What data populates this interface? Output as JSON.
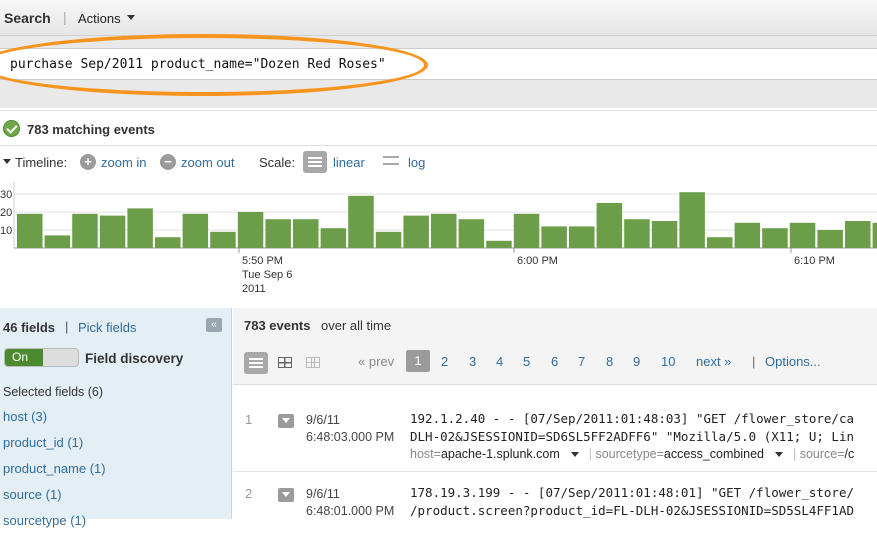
{
  "topbar": {
    "title": "Search",
    "actions_label": "Actions"
  },
  "search": {
    "query": "purchase Sep/2011 product_name=\"Dozen Red Roses\""
  },
  "results": {
    "matching_text": "783 matching events"
  },
  "timeline": {
    "label": "Timeline:",
    "zoom_in": "zoom in",
    "zoom_out": "zoom out",
    "scale_label": "Scale:",
    "linear": "linear",
    "log": "log"
  },
  "chart_data": {
    "type": "bar",
    "ylim": [
      0,
      30
    ],
    "yticks": [
      "30",
      "20",
      "10"
    ],
    "values": [
      19,
      7,
      19,
      18,
      22,
      6,
      19,
      9,
      20,
      16,
      16,
      11,
      29,
      9,
      18,
      19,
      16,
      4,
      19,
      12,
      12,
      25,
      16,
      15,
      31,
      6,
      14,
      11,
      14,
      10,
      15,
      14
    ],
    "xlabels": [
      {
        "lines": [
          "5:50 PM",
          "Tue Sep 6",
          "2011"
        ]
      },
      {
        "lines": [
          "6:00 PM"
        ]
      },
      {
        "lines": [
          "6:10 PM"
        ]
      }
    ],
    "bar_color": "#6c9e4a"
  },
  "sidebar": {
    "fields_count": "46 fields",
    "separator": "|",
    "pick_fields": "Pick fields",
    "collapse_glyph": "«",
    "toggle_on": "On",
    "field_discovery": "Field discovery",
    "selected_header": "Selected fields (6)",
    "fields": [
      "host (3)",
      "product_id (1)",
      "product_name (1)",
      "source (1)",
      "sourcetype (1)"
    ]
  },
  "main": {
    "events_count": "783 events",
    "events_suffix": " over all time",
    "prev": "« prev",
    "pages": [
      "1",
      "2",
      "3",
      "4",
      "5",
      "6",
      "7",
      "8",
      "9",
      "10"
    ],
    "next": "next »",
    "options": "Options...",
    "events": [
      {
        "num": "1",
        "date": "9/6/11",
        "time": "6:48:03.000 PM",
        "raw1": "192.1.2.40 - - [07/Sep/2011:01:48:03] \"GET /flower_store/ca",
        "raw2": "DLH-02&JSESSIONID=SD6SL5FF2ADFF6\" \"Mozilla/5.0 (X11; U; Lin",
        "host_key": "host=",
        "host_val": "apache-1.splunk.com",
        "st_key": "sourcetype=",
        "st_val": "access_combined",
        "src_key": "source=",
        "src_val": "/c"
      },
      {
        "num": "2",
        "date": "9/6/11",
        "time": "6:48:01.000 PM",
        "raw1": "178.19.3.199 - - [07/Sep/2011:01:48:01] \"GET /flower_store/",
        "raw2": "/product.screen?product_id=FL-DLH-02&JSESSIONID=SD5SL4FF1AD"
      }
    ]
  }
}
